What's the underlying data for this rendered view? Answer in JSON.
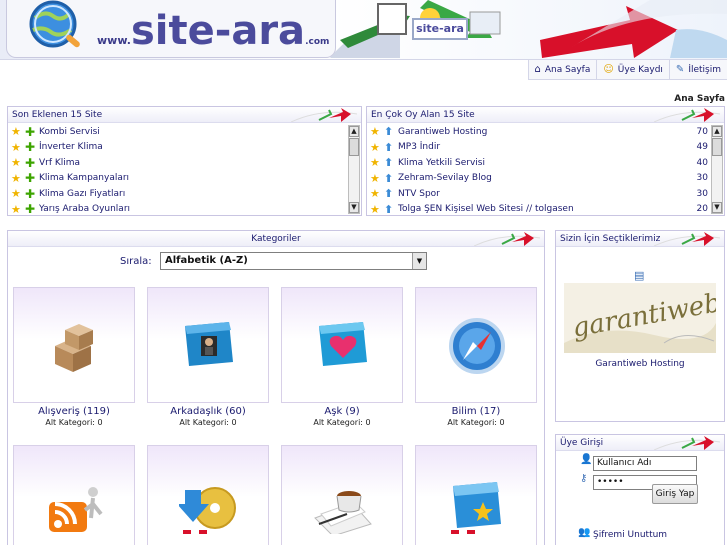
{
  "header": {
    "logo_www": "www.",
    "logo_main": "site-ara",
    "logo_com": ".com",
    "banner_tag": "site-ara"
  },
  "nav": {
    "home": "Ana Sayfa",
    "register": "Üye Kaydı",
    "contact": "İletişim"
  },
  "breadcrumb": "Ana Sayfa",
  "recent": {
    "title": "Son Eklenen 15 Site",
    "items": [
      "Kombi Servisi",
      "İnverter Klima",
      "Vrf Klima",
      "Klima Kampanyaları",
      "Klima Gazı Fiyatları",
      "Yarış Araba Oyunları"
    ]
  },
  "top_voted": {
    "title": "En Çok Oy Alan 15 Site",
    "items": [
      {
        "name": "Garantiweb Hosting",
        "votes": "70"
      },
      {
        "name": "MP3 İndir",
        "votes": "49"
      },
      {
        "name": "Klima Yetkili Servisi",
        "votes": "40"
      },
      {
        "name": "Zehram-Sevilay Blog",
        "votes": "30"
      },
      {
        "name": "NTV Spor",
        "votes": "30"
      },
      {
        "name": "Tolga ŞEN Kişisel Web Sitesi // tolgasen",
        "votes": "20"
      }
    ]
  },
  "categories": {
    "title": "Kategoriler",
    "sort_label": "Sırala:",
    "sort_value": "Alfabetik (A-Z)",
    "items": [
      {
        "name": "Alışveriş (119)",
        "sub": "Alt Kategori: 0",
        "icon": "boxes-icon"
      },
      {
        "name": "Arkadaşlık (60)",
        "sub": "Alt Kategori: 0",
        "icon": "friends-folder-icon"
      },
      {
        "name": "Aşk (9)",
        "sub": "Alt Kategori: 0",
        "icon": "heart-folder-icon"
      },
      {
        "name": "Bilim (17)",
        "sub": "Alt Kategori: 0",
        "icon": "compass-icon"
      },
      {
        "name": "",
        "sub": "",
        "icon": "rss-icon"
      },
      {
        "name": "",
        "sub": "",
        "icon": "cd-download-icon"
      },
      {
        "name": "",
        "sub": "",
        "icon": "coffee-mail-icon"
      },
      {
        "name": "",
        "sub": "",
        "icon": "star-folder-icon"
      }
    ]
  },
  "featured": {
    "title": "Sizin İçin Seçtiklerimiz",
    "logo_text": "garantiweb",
    "site_name": "Garantiweb Hosting"
  },
  "login": {
    "title": "Üye Girişi",
    "username_value": "Kullanıcı Adı",
    "password_value": "•••••",
    "button": "Giriş Yap",
    "forgot": "Şifremi Unuttum"
  },
  "colors": {
    "link": "#1a1a6e",
    "border": "#c9c5e2",
    "card_top": "#efe6fa",
    "star": "#f0b400",
    "plus": "#3da400"
  }
}
